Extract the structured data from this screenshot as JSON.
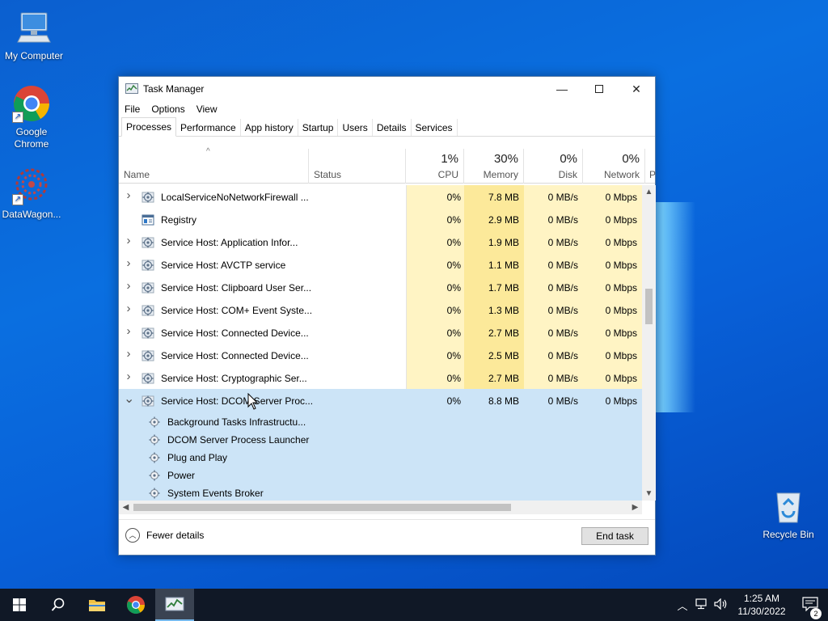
{
  "desktop": {
    "icons": [
      {
        "label": "My Computer"
      },
      {
        "label": "Google Chrome"
      },
      {
        "label": "DataWagon..."
      },
      {
        "label": "Recycle Bin"
      }
    ]
  },
  "window": {
    "title": "Task Manager",
    "menu": [
      "File",
      "Options",
      "View"
    ],
    "tabs": [
      "Processes",
      "Performance",
      "App history",
      "Startup",
      "Users",
      "Details",
      "Services"
    ],
    "active_tab": "Processes"
  },
  "columns": {
    "name": "Name",
    "status": "Status",
    "cpu": {
      "pct": "1%",
      "label": "CPU"
    },
    "memory": {
      "pct": "30%",
      "label": "Memory"
    },
    "disk": {
      "pct": "0%",
      "label": "Disk"
    },
    "network": {
      "pct": "0%",
      "label": "Network"
    },
    "power_truncated": "P"
  },
  "processes": [
    {
      "name": "LocalServiceNoNetworkFirewall ...",
      "cpu": "0%",
      "memory": "7.8 MB",
      "disk": "0 MB/s",
      "network": "0 Mbps",
      "expandable": true,
      "icon": "gear-icon"
    },
    {
      "name": "Registry",
      "cpu": "0%",
      "memory": "2.9 MB",
      "disk": "0 MB/s",
      "network": "0 Mbps",
      "expandable": false,
      "icon": "registry-icon"
    },
    {
      "name": "Service Host: Application Infor...",
      "cpu": "0%",
      "memory": "1.9 MB",
      "disk": "0 MB/s",
      "network": "0 Mbps",
      "expandable": true,
      "icon": "gear-icon"
    },
    {
      "name": "Service Host: AVCTP service",
      "cpu": "0%",
      "memory": "1.1 MB",
      "disk": "0 MB/s",
      "network": "0 Mbps",
      "expandable": true,
      "icon": "gear-icon"
    },
    {
      "name": "Service Host: Clipboard User Ser...",
      "cpu": "0%",
      "memory": "1.7 MB",
      "disk": "0 MB/s",
      "network": "0 Mbps",
      "expandable": true,
      "icon": "gear-icon"
    },
    {
      "name": "Service Host: COM+ Event Syste...",
      "cpu": "0%",
      "memory": "1.3 MB",
      "disk": "0 MB/s",
      "network": "0 Mbps",
      "expandable": true,
      "icon": "gear-icon"
    },
    {
      "name": "Service Host: Connected Device...",
      "cpu": "0%",
      "memory": "2.7 MB",
      "disk": "0 MB/s",
      "network": "0 Mbps",
      "expandable": true,
      "icon": "gear-icon"
    },
    {
      "name": "Service Host: Connected Device...",
      "cpu": "0%",
      "memory": "2.5 MB",
      "disk": "0 MB/s",
      "network": "0 Mbps",
      "expandable": true,
      "icon": "gear-icon"
    },
    {
      "name": "Service Host: Cryptographic Ser...",
      "cpu": "0%",
      "memory": "2.7 MB",
      "disk": "0 MB/s",
      "network": "0 Mbps",
      "expandable": true,
      "icon": "gear-icon"
    },
    {
      "name": "Service Host: DCOM Server Proc...",
      "cpu": "0%",
      "memory": "8.8 MB",
      "disk": "0 MB/s",
      "network": "0 Mbps",
      "expandable": true,
      "expanded": true,
      "icon": "gear-icon"
    }
  ],
  "child_services": [
    "Background Tasks Infrastructu...",
    "DCOM Server Process Launcher",
    "Plug and Play",
    "Power",
    "System Events Broker"
  ],
  "footer": {
    "fewer_details": "Fewer details",
    "end_task": "End task"
  },
  "taskbar": {
    "time": "1:25 AM",
    "date": "11/30/2022",
    "notifications": "2"
  },
  "colors": {
    "heat_light": "#fff4c4",
    "heat_row": "#fdf0b4",
    "selection": "#cce4f7"
  }
}
